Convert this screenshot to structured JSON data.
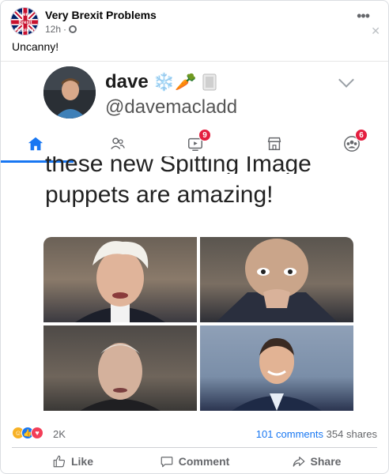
{
  "post": {
    "page_name": "Very Brexit Problems",
    "time": "12h",
    "separator": "·",
    "text": "Uncanny!",
    "avatar_logo_text": [
      "Very",
      "Brexit",
      "Problems"
    ]
  },
  "shared": {
    "tweet_user_name": "dave",
    "tweet_user_emojis": "❄️🥕",
    "tweet_handle": "@davemacladd",
    "tweet_text_line1": "these new Spitting Image",
    "tweet_text_line2": "puppets are amazing!"
  },
  "nav": {
    "items": [
      {
        "icon": "home-icon",
        "active": true
      },
      {
        "icon": "friends-icon"
      },
      {
        "icon": "watch-icon",
        "badge": "9"
      },
      {
        "icon": "marketplace-icon"
      },
      {
        "icon": "groups-icon",
        "badge": "6"
      }
    ]
  },
  "stats": {
    "reactions": [
      "haha",
      "like",
      "love"
    ],
    "reaction_count": "2K",
    "comments": "101 comments",
    "shares": "354 shares"
  },
  "actions": {
    "like": "Like",
    "comment": "Comment",
    "share": "Share"
  },
  "colors": {
    "accent": "#1877f2",
    "badge": "#e41e3f",
    "meta": "#65676b"
  }
}
